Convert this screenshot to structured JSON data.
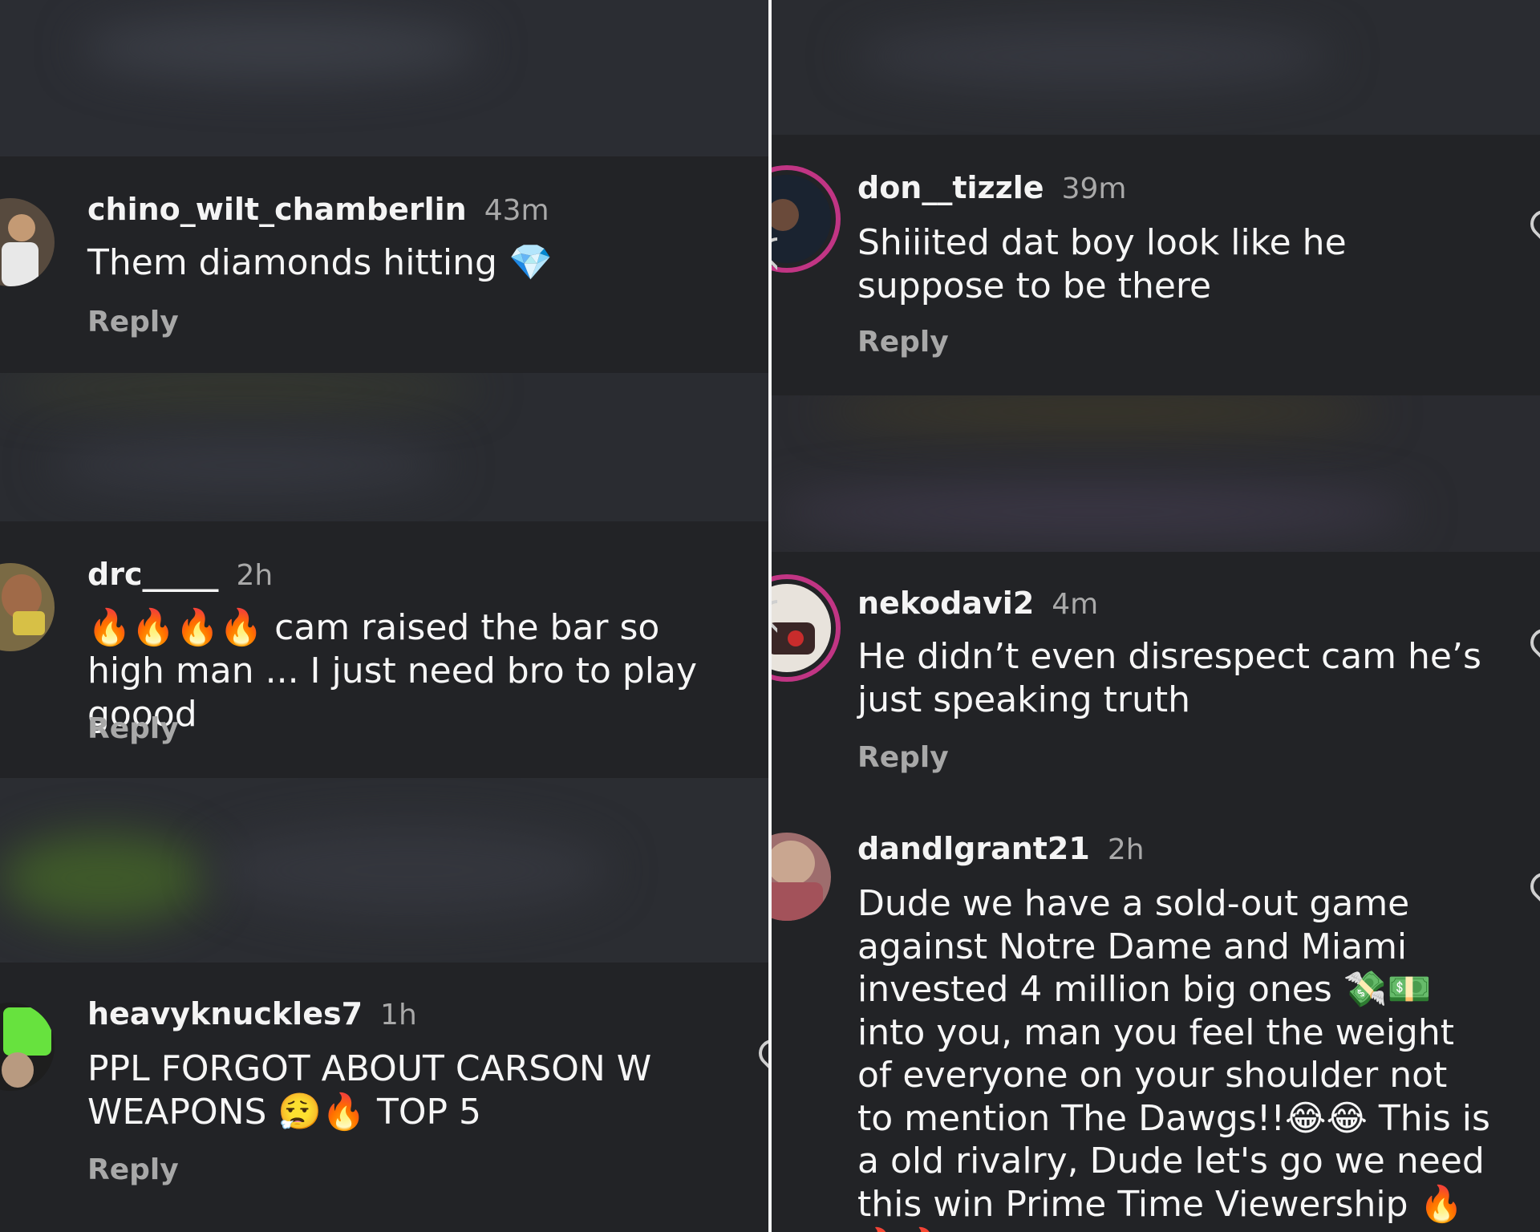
{
  "left_column": {
    "comments": [
      {
        "username": "chino_wilt_chamberlin",
        "time": "43m",
        "text": "Them diamonds hitting 💎",
        "reply": "Reply"
      },
      {
        "username": "drc_____",
        "time": "2h",
        "text": "🔥🔥🔥🔥 cam raised the bar so high man ... I just need bro to play goood",
        "reply": "Reply"
      },
      {
        "username": "heavyknuckles7",
        "time": "1h",
        "text": "PPL FORGOT ABOUT CARSON W WEAPONS 😮‍💨🔥 TOP 5",
        "reply": "Reply"
      }
    ]
  },
  "right_column": {
    "comments": [
      {
        "username": "don__tizzle",
        "time": "39m",
        "text": "Shiiited dat boy look like he suppose to be there",
        "reply": "Reply"
      },
      {
        "username": "nekodavi2",
        "time": "4m",
        "text": "He didn’t even disrespect cam he’s just speaking truth",
        "reply": "Reply"
      },
      {
        "username": "dandlgrant21",
        "time": "2h",
        "text": "Dude we have a sold-out game against Notre Dame and Miami invested 4 million big ones 💸💵 into you, man you feel the weight of everyone on your shoulder not to mention The Dawgs!!😂😂 This is a old rivalry, Dude let's go we need this win Prime Time Viewership 🔥🔥🔥"
      }
    ]
  },
  "colors": {
    "background": "#1c1d21",
    "card": "#222326",
    "story_ring": "#c13584",
    "muted_text": "#a9a9a9"
  },
  "icons": [
    "heart-outline-icon"
  ]
}
